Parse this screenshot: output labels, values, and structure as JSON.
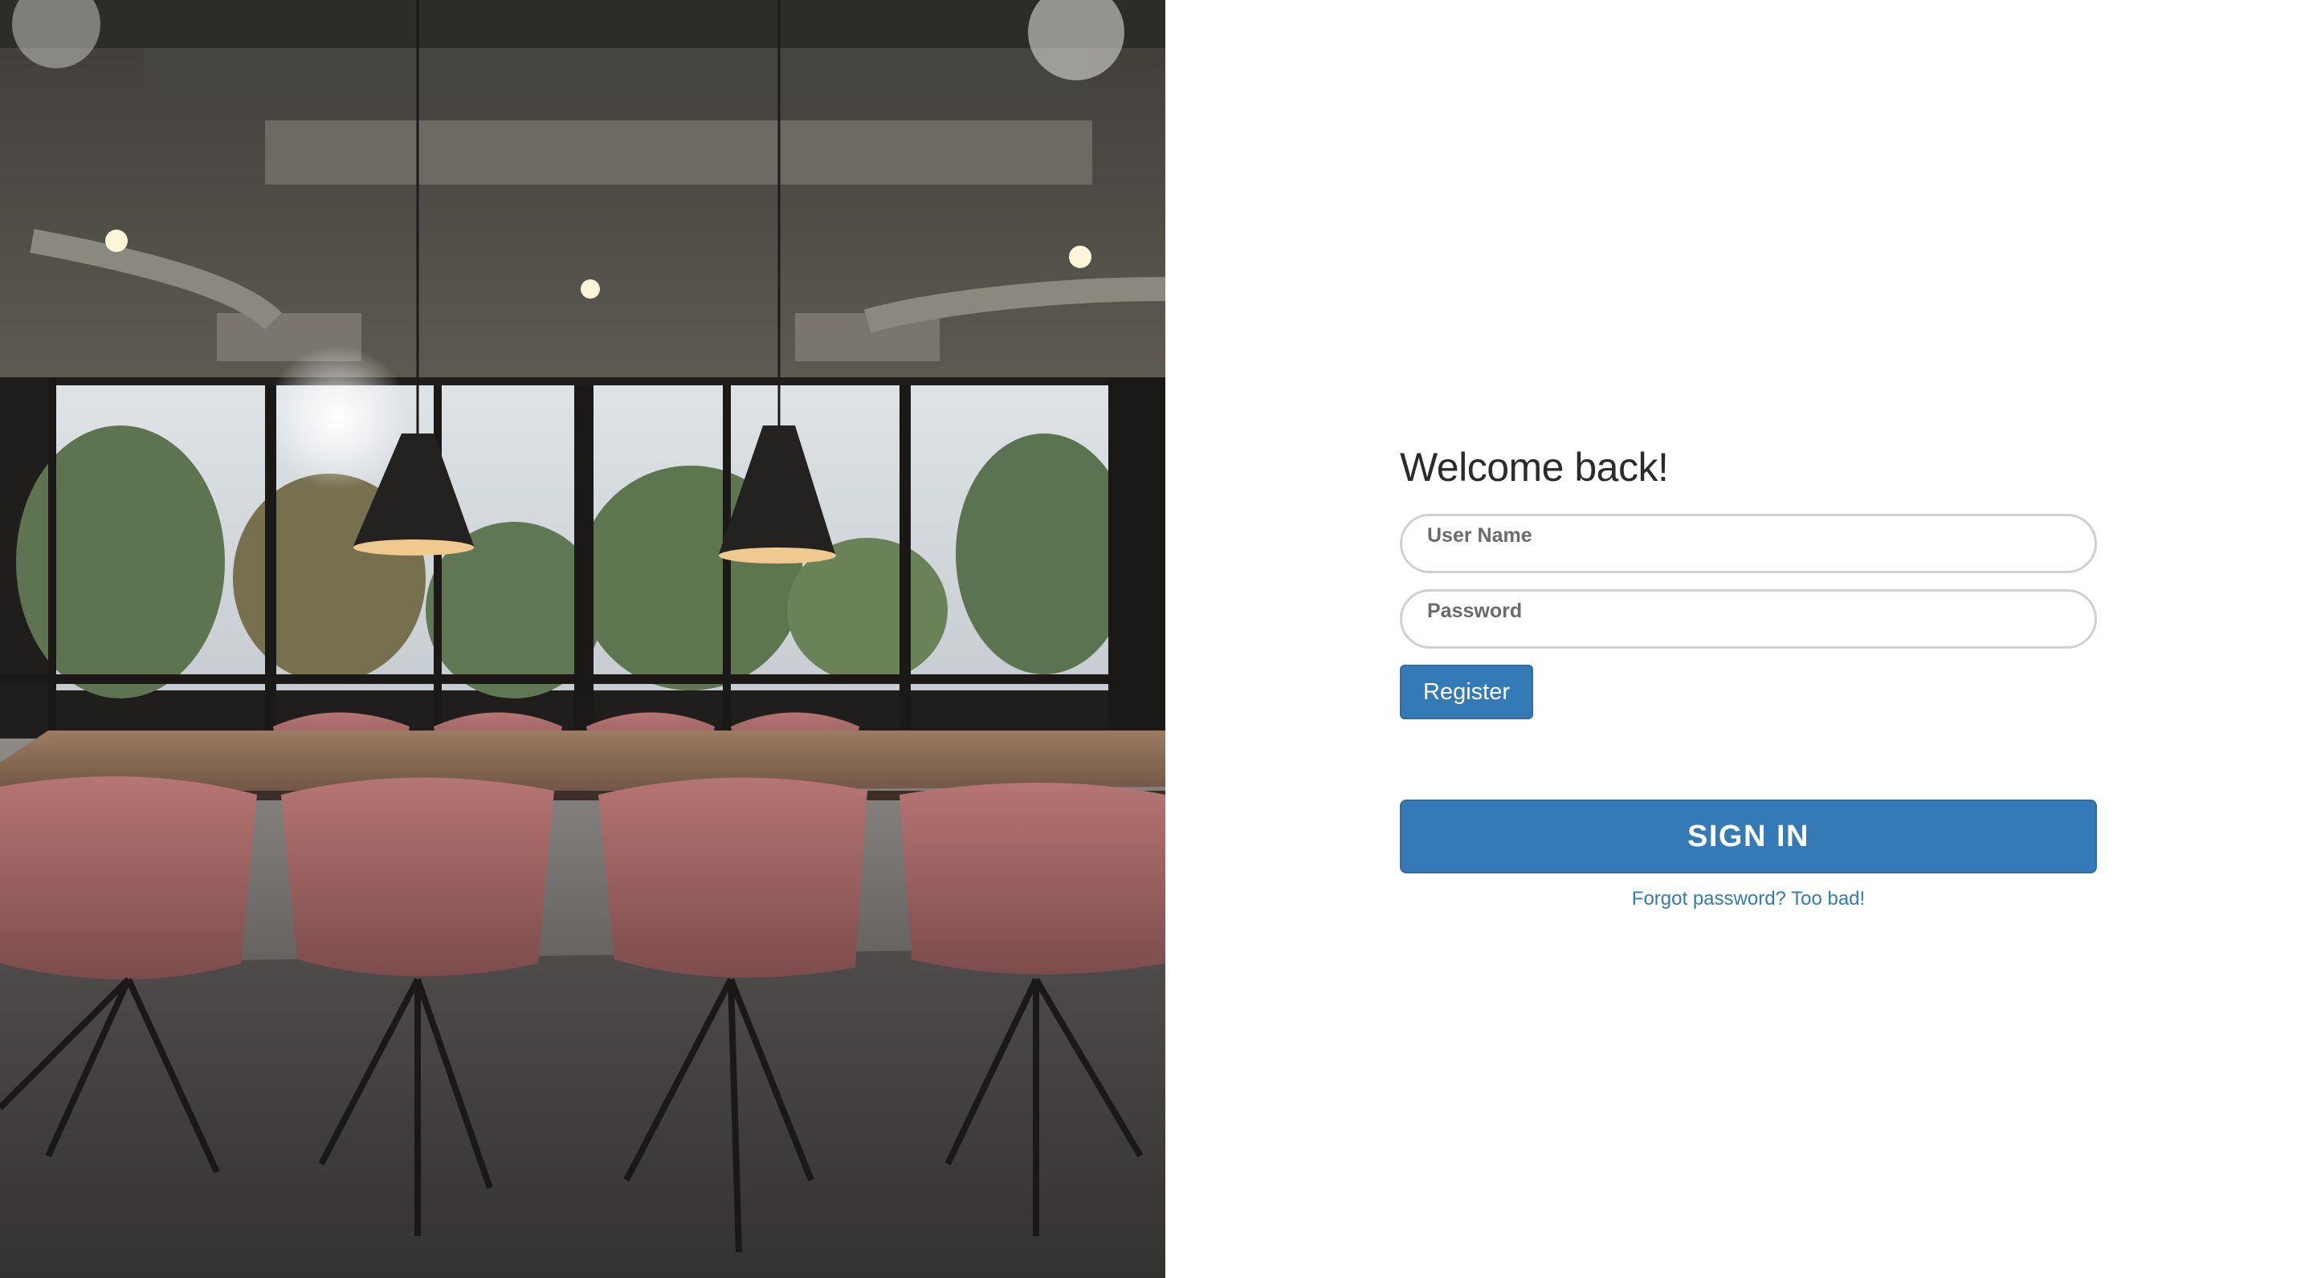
{
  "hero_image": {
    "icon": "conference-room-photo"
  },
  "login": {
    "heading": "Welcome back!",
    "username": {
      "label": "User Name",
      "value": ""
    },
    "password": {
      "label": "Password",
      "value": ""
    },
    "register_label": "Register",
    "signin_label": "SIGN IN",
    "forgot_label": "Forgot password? Too bad!"
  },
  "colors": {
    "primary": "#337ab7",
    "chair": "#b36f70",
    "border": "#d0d0d0"
  }
}
